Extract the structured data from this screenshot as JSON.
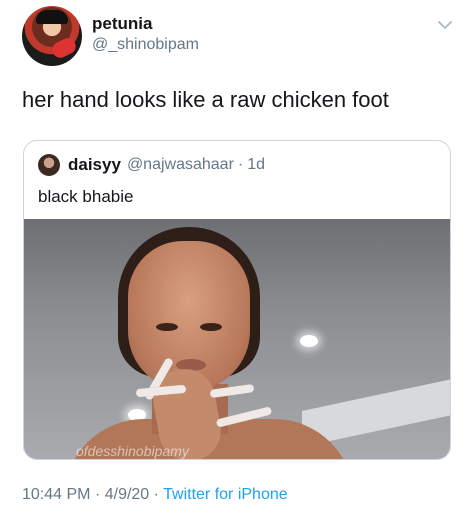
{
  "tweet": {
    "display_name": "petunia",
    "handle": "@_shinobipam",
    "text": "her hand looks like a raw chicken foot",
    "icons": {
      "avatar": "user-avatar",
      "menu": "chevron-down-icon"
    }
  },
  "quoted_tweet": {
    "display_name": "daisyy",
    "handle": "@najwasahaar",
    "separator": "·",
    "time": "1d",
    "text": "black bhabie",
    "media_watermark": "ofdesshinobipamy"
  },
  "meta": {
    "time": "10:44 PM",
    "separator1": "·",
    "date": "4/9/20",
    "separator2": "·",
    "source": "Twitter for iPhone"
  },
  "colors": {
    "text": "#14171a",
    "secondary": "#657786",
    "link": "#1da1f2",
    "border": "#ccd6dd"
  }
}
